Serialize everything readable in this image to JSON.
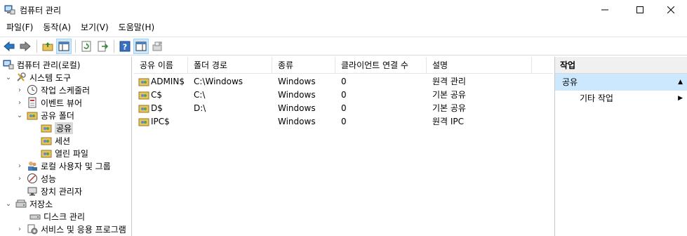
{
  "window": {
    "title": "컴퓨터 관리"
  },
  "menu": [
    "파일(F)",
    "동작(A)",
    "보기(V)",
    "도움말(H)"
  ],
  "tree": {
    "root": "컴퓨터 관리(로컬)",
    "system_tools": "시스템 도구",
    "task_scheduler": "작업 스케줄러",
    "event_viewer": "이벤트 뷰어",
    "shared_folders": "공유 폴더",
    "shares": "공유",
    "sessions": "세션",
    "open_files": "열린 파일",
    "local_users": "로컬 사용자 및 그룹",
    "performance": "성능",
    "device_manager": "장치 관리자",
    "storage": "저장소",
    "disk_management": "디스크 관리",
    "services": "서비스 및 응용 프로그램"
  },
  "list": {
    "columns": [
      "공유 이름",
      "폴더 경로",
      "종류",
      "클라이언트 연결 수",
      "설명"
    ],
    "rows": [
      {
        "name": "ADMIN$",
        "path": "C:\\Windows",
        "type": "Windows",
        "clients": "0",
        "desc": "원격 관리"
      },
      {
        "name": "C$",
        "path": "C:\\",
        "type": "Windows",
        "clients": "0",
        "desc": "기본 공유"
      },
      {
        "name": "D$",
        "path": "D:\\",
        "type": "Windows",
        "clients": "0",
        "desc": "기본 공유"
      },
      {
        "name": "IPC$",
        "path": "",
        "type": "Windows",
        "clients": "0",
        "desc": "원격 IPC"
      }
    ]
  },
  "actions": {
    "title": "작업",
    "section": "공유",
    "more": "기타 작업"
  }
}
